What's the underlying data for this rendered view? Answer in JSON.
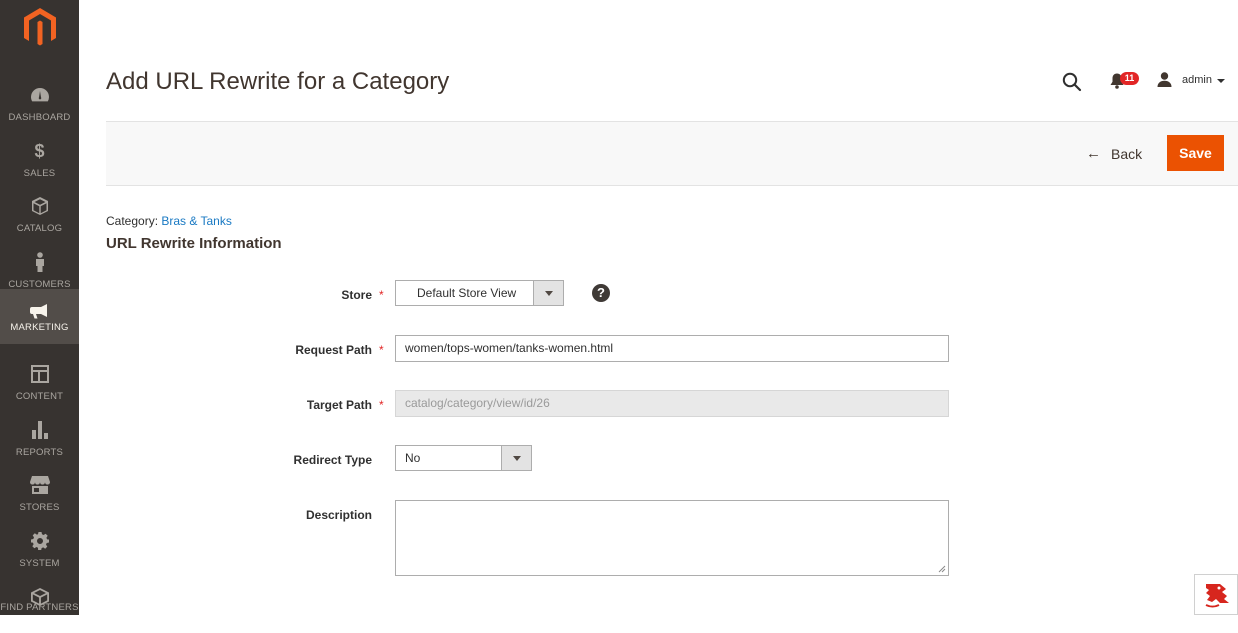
{
  "sidebar": {
    "items": [
      {
        "label": "Dashboard",
        "icon": "dashboard-icon"
      },
      {
        "label": "Sales",
        "icon": "dollar-icon",
        "glyph": "$"
      },
      {
        "label": "Catalog",
        "icon": "box-icon"
      },
      {
        "label": "Customers",
        "icon": "person-icon"
      },
      {
        "label": "Marketing",
        "icon": "megaphone-icon",
        "active": true
      },
      {
        "label": "Content",
        "icon": "layout-icon"
      },
      {
        "label": "Reports",
        "icon": "bar-chart-icon"
      },
      {
        "label": "Stores",
        "icon": "storefront-icon"
      },
      {
        "label": "System",
        "icon": "gear-icon"
      },
      {
        "label": "Find Partners",
        "icon": "partners-box-icon"
      }
    ]
  },
  "header": {
    "title": "Add URL Rewrite for a Category",
    "notification_count": "11",
    "user_name": "admin"
  },
  "actions": {
    "back_label": "Back",
    "save_label": "Save"
  },
  "form": {
    "category_prefix": "Category:",
    "category_name": "Bras & Tanks",
    "section_title": "URL Rewrite Information",
    "required_mark": "*",
    "help_glyph": "?",
    "store": {
      "label": "Store",
      "value": "Default Store View"
    },
    "request_path": {
      "label": "Request Path",
      "value": "women/tops-women/tanks-women.html"
    },
    "target_path": {
      "label": "Target Path",
      "value": "catalog/category/view/id/26"
    },
    "redirect_type": {
      "label": "Redirect Type",
      "value": "No"
    },
    "description": {
      "label": "Description",
      "value": ""
    }
  },
  "colors": {
    "sidebar_bg": "#373330",
    "sidebar_active": "#524d49",
    "accent": "#eb5202",
    "link": "#1979c3",
    "required": "#e22626"
  }
}
